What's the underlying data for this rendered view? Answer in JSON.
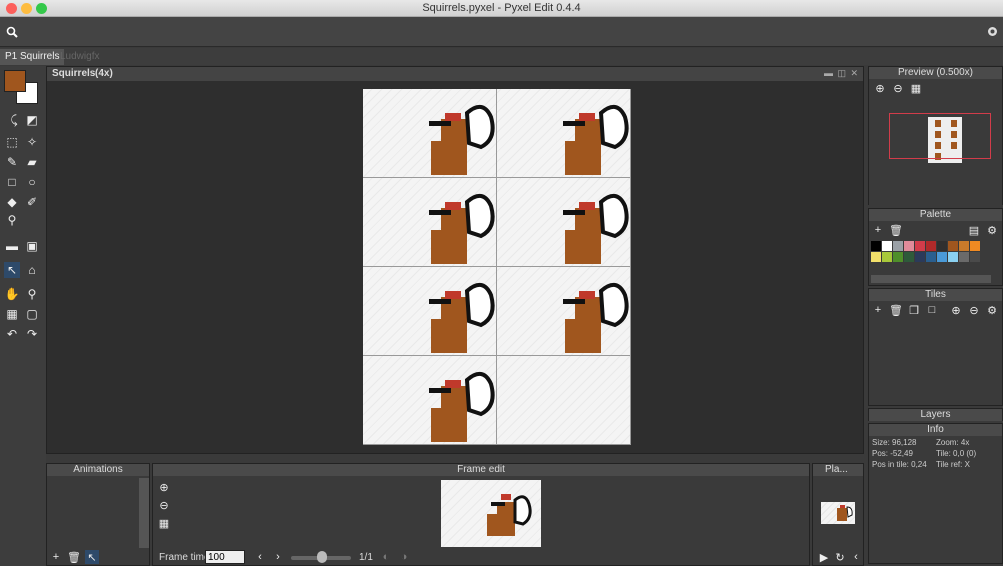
{
  "window": {
    "title": "Squirrels.pyxel - Pyxel Edit 0.4.4"
  },
  "tabs": [
    {
      "label": "P1 Squirrels"
    },
    {
      "label": "Ludwigfx"
    }
  ],
  "canvas": {
    "title": "Squirrels",
    "zoom": "(4x)"
  },
  "preview": {
    "title": "Preview (0.500x)"
  },
  "palette": {
    "title": "Palette",
    "colors": [
      "#000000",
      "#ffffff",
      "#9aa0a6",
      "#e08b9a",
      "#d23c4a",
      "#b02a2a",
      "#2f2f2f",
      "#a0561e",
      "#c87a2a",
      "#f08a22",
      "#f2e06a",
      "#a8c83a",
      "#4f8f2a",
      "#2e5a3a",
      "#2b3a5a",
      "#2a5f8f",
      "#4a9ad8",
      "#8ad0f0",
      "#6a6a6a",
      "#4a4a4a"
    ]
  },
  "tiles": {
    "title": "Tiles"
  },
  "layers": {
    "title": "Layers"
  },
  "info": {
    "title": "Info",
    "size": "Size: 96,128",
    "zoom": "Zoom: 4x",
    "pos": "Pos: -52,49",
    "tile": "Tile: 0,0 (0)",
    "pos_in_tile": "Pos in tile: 0,24",
    "tile_ref": "Tile ref: X"
  },
  "animations": {
    "title": "Animations"
  },
  "frame_edit": {
    "title": "Frame edit",
    "frame_time_label": "Frame time",
    "frame_time_value": "100",
    "frame_counter": "1/1"
  },
  "playback": {
    "title": "Pla..."
  }
}
